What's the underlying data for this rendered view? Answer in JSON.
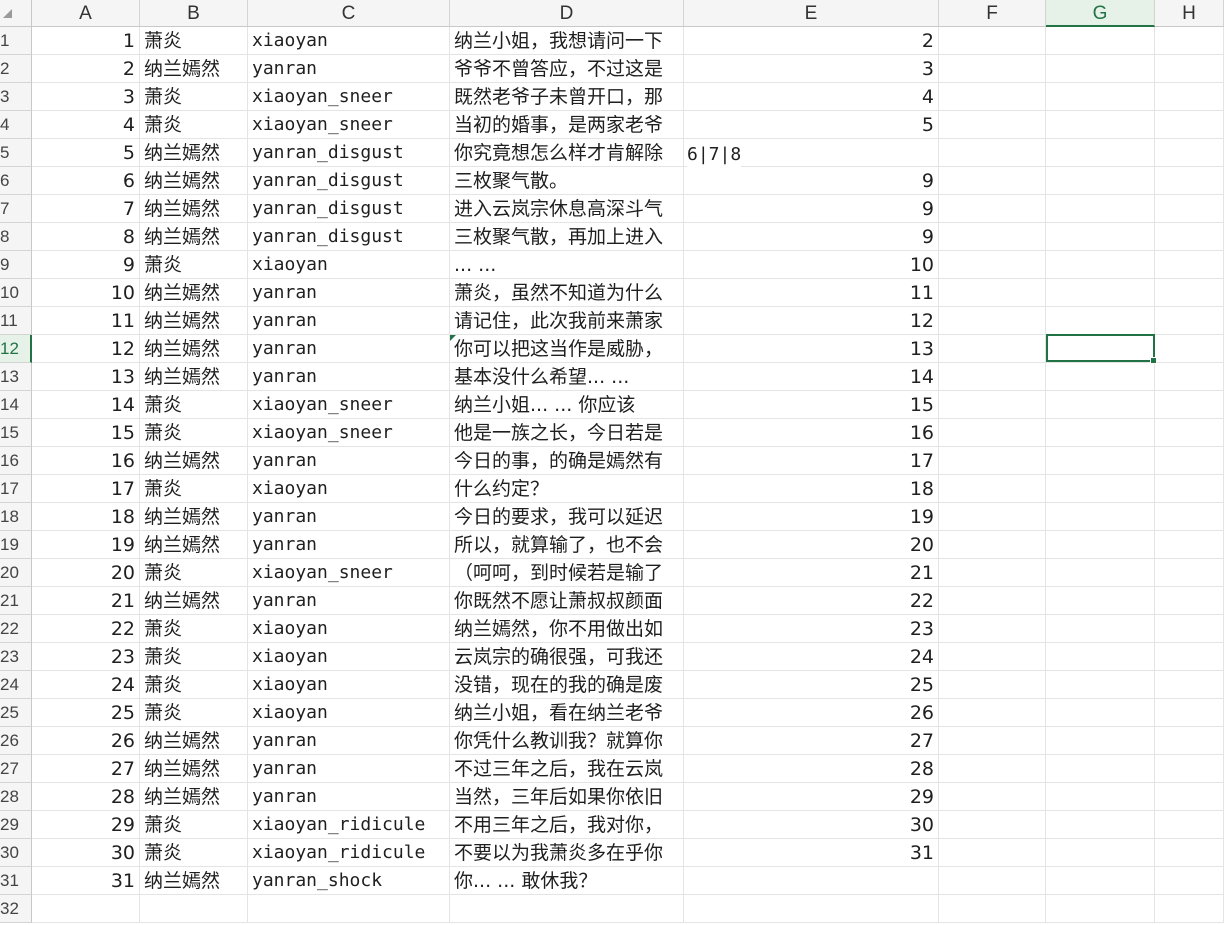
{
  "columns": [
    "A",
    "B",
    "C",
    "D",
    "E",
    "F",
    "G",
    "H"
  ],
  "active_column": "G",
  "active_row": 12,
  "row_count": 32,
  "rows": [
    {
      "a": "1",
      "b": "萧炎",
      "c": "xiaoyan",
      "d": "纳兰小姐，我想请问一下",
      "e": "2"
    },
    {
      "a": "2",
      "b": "纳兰嫣然",
      "c": "yanran",
      "d": "爷爷不曾答应，不过这是",
      "e": "3"
    },
    {
      "a": "3",
      "b": "萧炎",
      "c": "xiaoyan_sneer",
      "d": "既然老爷子未曾开口，那",
      "e": "4"
    },
    {
      "a": "4",
      "b": "萧炎",
      "c": "xiaoyan_sneer",
      "d": "当初的婚事，是两家老爷",
      "e": "5"
    },
    {
      "a": "5",
      "b": "纳兰嫣然",
      "c": "yanran_disgust",
      "d": "你究竟想怎么样才肯解除",
      "e": ""
    },
    {
      "a": "6",
      "b": "纳兰嫣然",
      "c": "yanran_disgust",
      "d": "三枚聚气散。",
      "e": "9"
    },
    {
      "a": "7",
      "b": "纳兰嫣然",
      "c": "yanran_disgust",
      "d": "进入云岚宗休息高深斗气",
      "e": "9"
    },
    {
      "a": "8",
      "b": "纳兰嫣然",
      "c": "yanran_disgust",
      "d": "三枚聚气散，再加上进入",
      "e": "9"
    },
    {
      "a": "9",
      "b": "萧炎",
      "c": "xiaoyan",
      "d": "... ...",
      "e": "10"
    },
    {
      "a": "10",
      "b": "纳兰嫣然",
      "c": "yanran",
      "d": "萧炎，虽然不知道为什么",
      "e": "11"
    },
    {
      "a": "11",
      "b": "纳兰嫣然",
      "c": "yanran",
      "d": "请记住，此次我前来萧家",
      "e": "12"
    },
    {
      "a": "12",
      "b": "纳兰嫣然",
      "c": "yanran",
      "d": "你可以把这当作是威胁，",
      "e": "13"
    },
    {
      "a": "13",
      "b": "纳兰嫣然",
      "c": "yanran",
      "d": "基本没什么希望... ...",
      "e": "14"
    },
    {
      "a": "14",
      "b": "萧炎",
      "c": "xiaoyan_sneer",
      "d": "纳兰小姐... ... 你应该",
      "e": "15"
    },
    {
      "a": "15",
      "b": "萧炎",
      "c": "xiaoyan_sneer",
      "d": "他是一族之长，今日若是",
      "e": "16"
    },
    {
      "a": "16",
      "b": "纳兰嫣然",
      "c": "yanran",
      "d": "今日的事，的确是嫣然有",
      "e": "17"
    },
    {
      "a": "17",
      "b": "萧炎",
      "c": "xiaoyan",
      "d": "什么约定？",
      "e": "18"
    },
    {
      "a": "18",
      "b": "纳兰嫣然",
      "c": "yanran",
      "d": "今日的要求，我可以延迟",
      "e": "19"
    },
    {
      "a": "19",
      "b": "纳兰嫣然",
      "c": "yanran",
      "d": "所以，就算输了，也不会",
      "e": "20"
    },
    {
      "a": "20",
      "b": "萧炎",
      "c": "xiaoyan_sneer",
      "d": "（呵呵，到时候若是输了",
      "e": "21"
    },
    {
      "a": "21",
      "b": "纳兰嫣然",
      "c": "yanran",
      "d": "你既然不愿让萧叔叔颜面",
      "e": "22"
    },
    {
      "a": "22",
      "b": "萧炎",
      "c": "xiaoyan",
      "d": "纳兰嫣然，你不用做出如",
      "e": "23"
    },
    {
      "a": "23",
      "b": "萧炎",
      "c": "xiaoyan",
      "d": "云岚宗的确很强，可我还",
      "e": "24"
    },
    {
      "a": "24",
      "b": "萧炎",
      "c": "xiaoyan",
      "d": "没错，现在的我的确是废",
      "e": "25"
    },
    {
      "a": "25",
      "b": "萧炎",
      "c": "xiaoyan",
      "d": "纳兰小姐，看在纳兰老爷",
      "e": "26"
    },
    {
      "a": "26",
      "b": "纳兰嫣然",
      "c": "yanran",
      "d": "你凭什么教训我？就算你",
      "e": "27"
    },
    {
      "a": "27",
      "b": "纳兰嫣然",
      "c": "yanran",
      "d": "不过三年之后，我在云岚",
      "e": "28"
    },
    {
      "a": "28",
      "b": "纳兰嫣然",
      "c": "yanran",
      "d": "当然，三年后如果你依旧",
      "e": "29"
    },
    {
      "a": "29",
      "b": "萧炎",
      "c": "xiaoyan_ridicule",
      "d": "不用三年之后，我对你，",
      "e": "30"
    },
    {
      "a": "30",
      "b": "萧炎",
      "c": "xiaoyan_ridicule",
      "d": "不要以为我萧炎多在乎你",
      "e": "31"
    },
    {
      "a": "31",
      "b": "纳兰嫣然",
      "c": "yanran_shock",
      "d": "你... ... 敢休我？",
      "e": ""
    },
    {
      "a": "",
      "b": "",
      "c": "",
      "d": "",
      "e": ""
    }
  ],
  "overflow_text_row5": "6|7|8",
  "colors": {
    "accent": "#217346",
    "header_bg": "#f5f5f5",
    "gridline": "#e4e4e4"
  }
}
